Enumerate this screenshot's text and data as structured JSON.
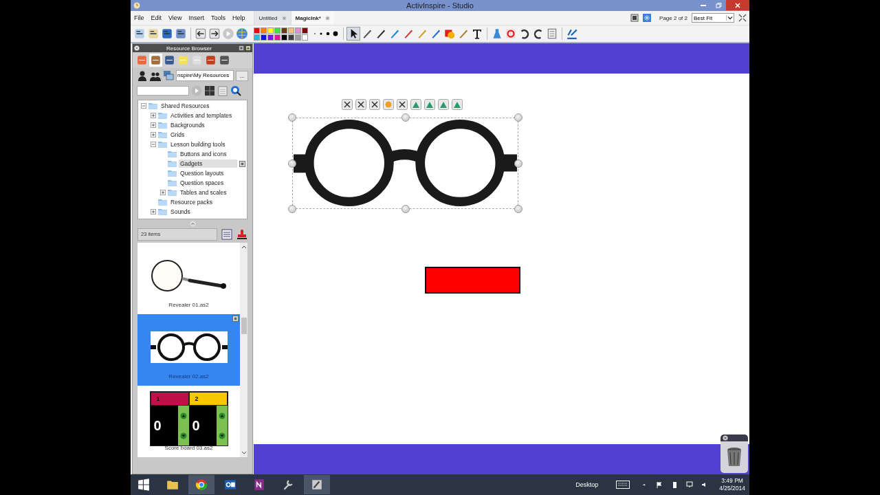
{
  "window": {
    "title": "ActivInspire - Studio"
  },
  "menu": [
    "File",
    "Edit",
    "View",
    "Insert",
    "Tools",
    "Help"
  ],
  "doc_tabs": [
    {
      "label": "Untitled",
      "selected": false
    },
    {
      "label": "MagicInk*",
      "selected": true
    }
  ],
  "page_indicator": "Page 2 of 2",
  "zoom_select": {
    "value": "Best Fit"
  },
  "palette": [
    {
      "color": "#e01010"
    },
    {
      "color": "#ff7a10"
    },
    {
      "color": "#ffff20"
    },
    {
      "color": "#40e040"
    },
    {
      "color": "#6a3a10"
    },
    {
      "color": "#f0c080"
    },
    {
      "color": "#e090d0"
    },
    {
      "color": "#800808"
    },
    {
      "color": "#20c0e0"
    },
    {
      "color": "#1010f0"
    },
    {
      "color": "#8010f0"
    },
    {
      "color": "#f010a0"
    },
    {
      "color": "#000000"
    },
    {
      "color": "#404040"
    },
    {
      "color": "#a0a0a0"
    },
    {
      "color": "#ffffff"
    }
  ],
  "resource_browser": {
    "title": "Resource Browser",
    "path": "nspire\\My Resources",
    "browse_button": "...",
    "tree": [
      {
        "label": "Shared Resources",
        "expanded": true,
        "selected": false,
        "children": [
          {
            "label": "Activities and templates",
            "expanded": false,
            "selected": false
          },
          {
            "label": "Backgrounds",
            "expanded": false,
            "selected": false
          },
          {
            "label": "Grids",
            "expanded": false,
            "selected": false
          },
          {
            "label": "Lesson building tools",
            "expanded": true,
            "selected": false,
            "children": [
              {
                "label": "Buttons and icons",
                "selected": false
              },
              {
                "label": "Gadgets",
                "selected": true
              },
              {
                "label": "Question layouts",
                "selected": false
              },
              {
                "label": "Question spaces",
                "selected": false
              },
              {
                "label": "Tables and scales",
                "expanded": false,
                "selected": false
              }
            ]
          },
          {
            "label": "Resource packs",
            "selected": false
          },
          {
            "label": "Sounds",
            "expanded": false,
            "selected": false
          }
        ]
      }
    ],
    "item_count": "23 items",
    "resources": [
      {
        "kind": "magnifier",
        "label": "Revealer 01.as2",
        "selected": false
      },
      {
        "kind": "glasses",
        "label": "Revealer 02.as2",
        "selected": true
      },
      {
        "kind": "scoreboard",
        "label": "Score board 03.as2",
        "selected": false,
        "teams": [
          {
            "label": "1",
            "score": "0",
            "color": "#c0104a"
          },
          {
            "label": "2",
            "score": "0",
            "color": "#f8c800"
          }
        ]
      }
    ]
  },
  "taskbar": {
    "desktop_label": "Desktop",
    "time": "3:49 PM",
    "date": "4/25/2014"
  }
}
